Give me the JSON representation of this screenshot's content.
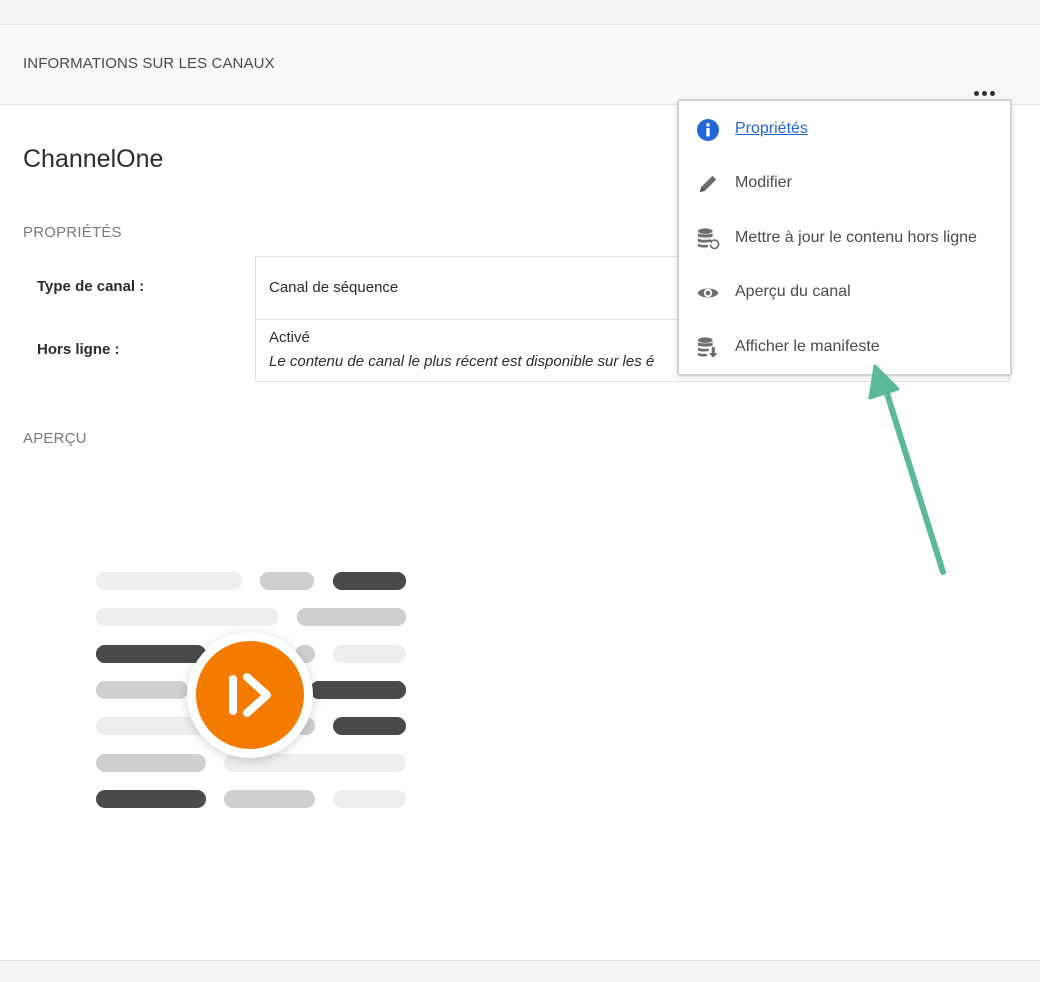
{
  "header": {
    "title": "INFORMATIONS SUR LES CANAUX",
    "more_icon": "more-horizontal-icon"
  },
  "channel": {
    "name": "ChannelOne"
  },
  "properties": {
    "heading": "PROPRIÉTÉS",
    "rows": [
      {
        "label": "Type de canal :",
        "value": "Canal de séquence"
      },
      {
        "label": "Hors ligne :",
        "value": "Activé",
        "note": "Le contenu de canal le plus récent est disponible sur les é"
      }
    ]
  },
  "preview": {
    "heading": "APERÇU",
    "icon": "sequence-channel-play-icon",
    "accent_color": "#f47b00"
  },
  "menu": {
    "items": [
      {
        "label": "Propriétés",
        "icon": "info-icon",
        "active": true
      },
      {
        "label": "Modifier",
        "icon": "pencil-icon"
      },
      {
        "label": "Mettre à jour le contenu hors ligne",
        "icon": "database-refresh-icon"
      },
      {
        "label": "Aperçu du canal",
        "icon": "eye-icon"
      },
      {
        "label": "Afficher le manifeste",
        "icon": "database-download-icon"
      }
    ],
    "active_color": "#2068d5"
  },
  "annotation": {
    "arrow_color": "#5bb89a",
    "points_to": "Afficher le manifeste"
  }
}
